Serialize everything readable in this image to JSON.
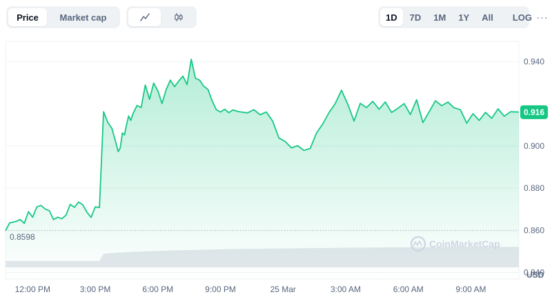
{
  "toolbar": {
    "type_tabs": [
      "Price",
      "Market cap"
    ],
    "active_type": "Price",
    "style_icons": [
      "line-chart-icon",
      "candlestick-icon"
    ],
    "ranges": [
      "1D",
      "7D",
      "1M",
      "1Y",
      "All"
    ],
    "active_range": "1D",
    "log_label": "LOG",
    "more_label": "···"
  },
  "watermark": "CoinMarketCap",
  "colors": {
    "line": "#16c784",
    "fill_top": "#16c784",
    "volume": "#e4e7ec",
    "grid": "#eff2f5",
    "baseline": "#a6b0c3"
  },
  "chart_data": {
    "type": "line",
    "y_ticks": [
      "0.940",
      "0.916",
      "0.900",
      "0.880",
      "0.860",
      "0.840"
    ],
    "y_tick_values": [
      0.94,
      0.92,
      0.9,
      0.88,
      0.86,
      0.84
    ],
    "ylim": [
      0.8369,
      0.9496
    ],
    "x_ticks": [
      "12:00 PM",
      "3:00 PM",
      "6:00 PM",
      "9:00 PM",
      "25 Mar",
      "3:00 AM",
      "6:00 AM",
      "9:00 AM"
    ],
    "x_tick_hours": [
      12,
      15,
      18,
      21,
      24,
      27,
      30,
      33
    ],
    "xlim_hours": [
      10.7,
      35.3
    ],
    "unit_label": "USD",
    "current_price": 0.916,
    "current_price_label": "0.916",
    "open_price": 0.8598,
    "open_price_label": "0.8598",
    "series": [
      {
        "x": [
          10.7,
          10.9,
          11.2,
          11.4,
          11.6,
          11.8,
          12.0,
          12.2,
          12.4,
          12.6,
          12.8,
          13.0,
          13.2,
          13.4,
          13.6,
          13.8,
          14.0,
          14.2,
          14.4,
          14.6,
          14.8,
          15.0,
          15.2,
          15.4,
          15.6,
          15.8,
          16.0,
          16.1,
          16.2,
          16.3,
          16.4,
          16.5,
          16.6,
          16.7,
          16.8,
          17.0,
          17.2,
          17.4,
          17.6,
          17.8,
          18.0,
          18.2,
          18.4,
          18.6,
          18.8,
          19.0,
          19.2,
          19.4,
          19.6,
          19.8,
          20.0,
          20.2,
          20.4,
          20.6,
          20.8,
          21.0,
          21.2,
          21.4,
          21.6,
          21.8,
          22.0,
          22.3,
          22.6,
          22.9,
          23.2,
          23.5,
          23.8,
          24.1,
          24.4,
          24.7,
          25.0,
          25.3,
          25.6,
          25.9,
          26.2,
          26.5,
          26.8,
          27.1,
          27.4,
          27.7,
          28.0,
          28.3,
          28.6,
          28.9,
          29.2,
          29.5,
          29.8,
          30.1,
          30.4,
          30.7,
          31.0,
          31.3,
          31.6,
          31.9,
          32.2,
          32.5,
          32.8,
          33.1,
          33.4,
          33.7,
          34.0,
          34.3,
          34.6,
          34.9,
          35.3
        ],
        "y": [
          0.8598,
          0.8635,
          0.8642,
          0.8651,
          0.8633,
          0.8688,
          0.8662,
          0.8711,
          0.8718,
          0.8701,
          0.8693,
          0.8651,
          0.8662,
          0.8655,
          0.8672,
          0.8723,
          0.8709,
          0.8734,
          0.8721,
          0.8686,
          0.8661,
          0.8711,
          0.8708,
          0.9162,
          0.9112,
          0.9083,
          0.9011,
          0.8973,
          0.8991,
          0.9062,
          0.9052,
          0.9101,
          0.9142,
          0.9121,
          0.9151,
          0.9192,
          0.9182,
          0.9289,
          0.9221,
          0.9298,
          0.9261,
          0.9201,
          0.9268,
          0.9312,
          0.9281,
          0.9308,
          0.9331,
          0.9291,
          0.9411,
          0.9321,
          0.9312,
          0.9283,
          0.9268,
          0.9214,
          0.9172,
          0.9161,
          0.9174,
          0.9158,
          0.9171,
          0.9164,
          0.9161,
          0.9157,
          0.9172,
          0.9148,
          0.9161,
          0.9118,
          0.9038,
          0.9021,
          0.8991,
          0.9001,
          0.8979,
          0.8988,
          0.9061,
          0.9104,
          0.9158,
          0.9201,
          0.9264,
          0.9198,
          0.9118,
          0.9202,
          0.9182,
          0.9211,
          0.9174,
          0.9209,
          0.9159,
          0.9178,
          0.9201,
          0.9149,
          0.9219,
          0.9111,
          0.9162,
          0.9214,
          0.9191,
          0.9208,
          0.9181,
          0.9172,
          0.9108,
          0.9153,
          0.9121,
          0.9159,
          0.9131,
          0.9176,
          0.9141,
          0.9162,
          0.9161
        ]
      }
    ],
    "volume": {
      "x": [
        10.7,
        15.2,
        15.4,
        16.2,
        17.0,
        18.0,
        19.0,
        20.0,
        21.0,
        22.0,
        23.0,
        24.0,
        25.0,
        26.0,
        27.0,
        28.0,
        29.0,
        30.0,
        31.0,
        32.0,
        33.0,
        34.0,
        35.3
      ],
      "rel": [
        0.28,
        0.28,
        0.6,
        0.65,
        0.69,
        0.72,
        0.75,
        0.77,
        0.79,
        0.81,
        0.82,
        0.83,
        0.84,
        0.85,
        0.86,
        0.87,
        0.875,
        0.88,
        0.885,
        0.89,
        0.895,
        0.9,
        0.9
      ]
    }
  }
}
